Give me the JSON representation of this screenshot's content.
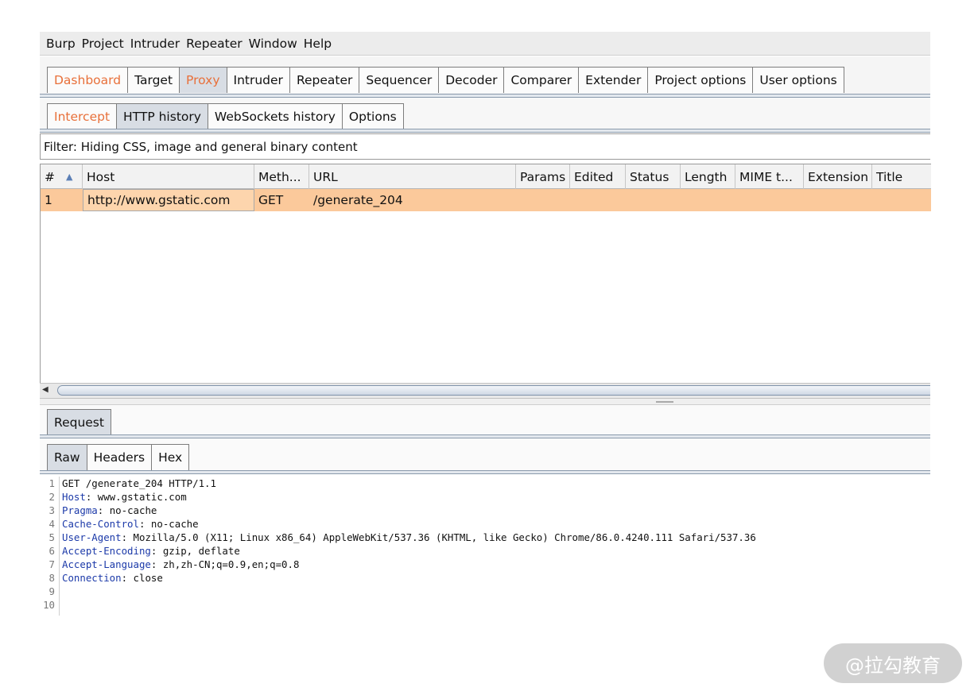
{
  "menu": [
    "Burp",
    "Project",
    "Intruder",
    "Repeater",
    "Window",
    "Help"
  ],
  "main_tabs": [
    {
      "label": "Dashboard",
      "state": "orange"
    },
    {
      "label": "Target",
      "state": ""
    },
    {
      "label": "Proxy",
      "state": "orange sel"
    },
    {
      "label": "Intruder",
      "state": ""
    },
    {
      "label": "Repeater",
      "state": ""
    },
    {
      "label": "Sequencer",
      "state": ""
    },
    {
      "label": "Decoder",
      "state": ""
    },
    {
      "label": "Comparer",
      "state": ""
    },
    {
      "label": "Extender",
      "state": ""
    },
    {
      "label": "Project options",
      "state": ""
    },
    {
      "label": "User options",
      "state": ""
    }
  ],
  "proxy_tabs": [
    {
      "label": "Intercept",
      "state": "orange"
    },
    {
      "label": "HTTP history",
      "state": "sel"
    },
    {
      "label": "WebSockets history",
      "state": ""
    },
    {
      "label": "Options",
      "state": ""
    }
  ],
  "filter_text": "Filter: Hiding CSS, image and general binary content",
  "table": {
    "columns": [
      "#",
      "Host",
      "Meth...",
      "URL",
      "Params",
      "Edited",
      "Status",
      "Length",
      "MIME t...",
      "Extension",
      "Title"
    ],
    "sort_icon": "sort-ascending-icon",
    "rows": [
      {
        "num": "1",
        "host": "http://www.gstatic.com",
        "method": "GET",
        "url": "/generate_204",
        "params": "",
        "edited": "",
        "status": "",
        "length": "",
        "mime": "",
        "extension": "",
        "title": ""
      }
    ]
  },
  "request_tab": "Request",
  "format_tabs": [
    {
      "label": "Raw",
      "state": "sel"
    },
    {
      "label": "Headers",
      "state": ""
    },
    {
      "label": "Hex",
      "state": ""
    }
  ],
  "request_lines": [
    {
      "n": "1",
      "key": "",
      "sep": "",
      "val": "GET /generate_204 HTTP/1.1"
    },
    {
      "n": "2",
      "key": "Host",
      "sep": ": ",
      "val": "www.gstatic.com"
    },
    {
      "n": "3",
      "key": "Pragma",
      "sep": ": ",
      "val": "no-cache"
    },
    {
      "n": "4",
      "key": "Cache-Control",
      "sep": ": ",
      "val": "no-cache"
    },
    {
      "n": "5",
      "key": "User-Agent",
      "sep": ": ",
      "val": "Mozilla/5.0 (X11; Linux x86_64) AppleWebKit/537.36 (KHTML, like Gecko) Chrome/86.0.4240.111 Safari/537.36"
    },
    {
      "n": "6",
      "key": "Accept-Encoding",
      "sep": ": ",
      "val": "gzip, deflate"
    },
    {
      "n": "7",
      "key": "Accept-Language",
      "sep": ": ",
      "val": "zh,zh-CN;q=0.9,en;q=0.8"
    },
    {
      "n": "8",
      "key": "Connection",
      "sep": ": ",
      "val": "close"
    },
    {
      "n": "9",
      "key": "",
      "sep": "",
      "val": ""
    },
    {
      "n": "10",
      "key": "",
      "sep": "",
      "val": ""
    }
  ],
  "watermark": "@拉勾教育",
  "colors": {
    "accent_orange": "#e8703a",
    "selected_row": "#fbc99b",
    "header_key": "#1c3aa9"
  }
}
